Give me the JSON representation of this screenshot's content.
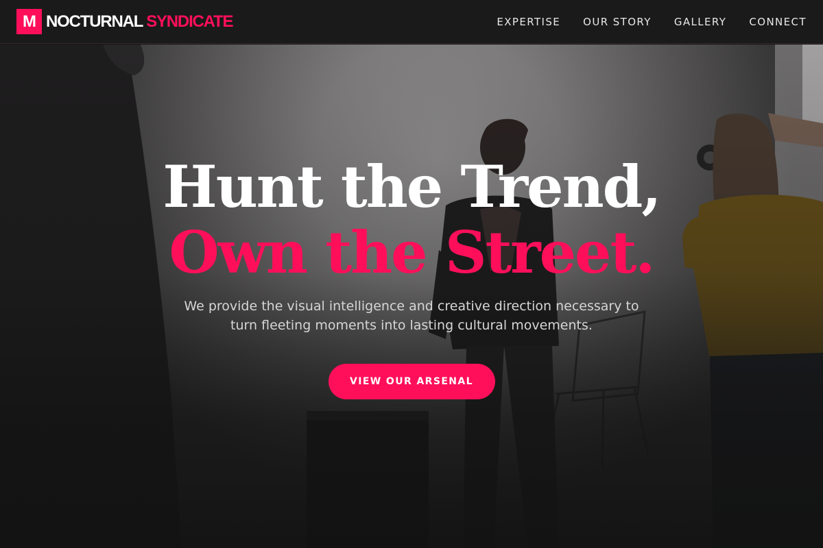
{
  "brand": {
    "mark": "M",
    "name_part1": "NOCTURNAL",
    "name_part2": "SYNDICATE",
    "accent_color": "#ff0f5a"
  },
  "nav": {
    "items": [
      {
        "label": "EXPERTISE"
      },
      {
        "label": "OUR STORY"
      },
      {
        "label": "GALLERY"
      },
      {
        "label": "CONNECT"
      }
    ]
  },
  "hero": {
    "headline_line1": "Hunt the Trend,",
    "headline_line2": "Own the Street.",
    "subtitle": "We provide the visual intelligence and creative direction necessary to turn fleeting moments into lasting cultural movements.",
    "cta_label": "VIEW OUR ARSENAL",
    "background": "photo-shoot-studio-scene"
  }
}
